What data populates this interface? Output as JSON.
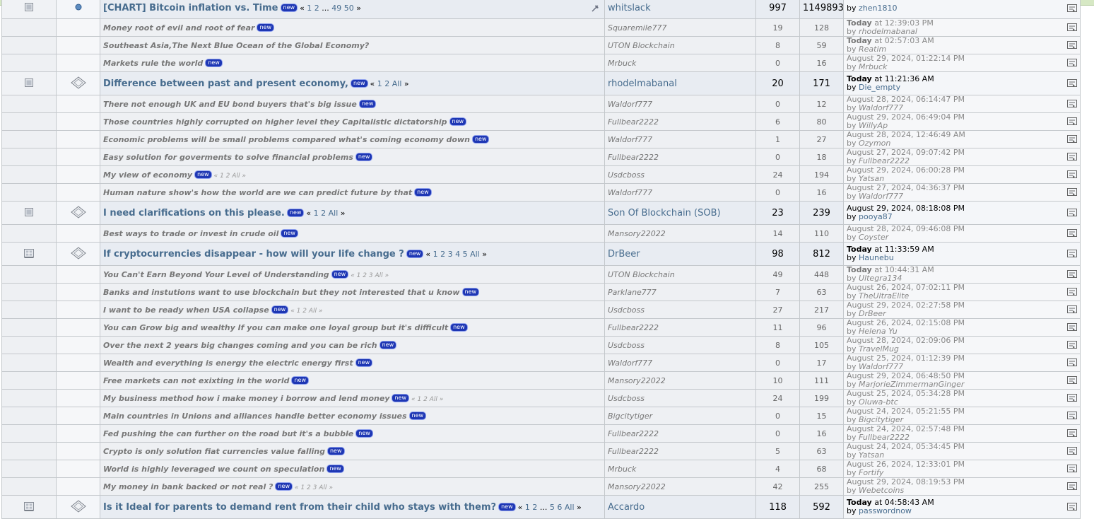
{
  "topics": [
    {
      "kind": "main",
      "top": true,
      "title": "[CHART] Bitcoin inflation vs. Time",
      "new": true,
      "pages": [
        "1",
        "2",
        "...",
        "49",
        "50"
      ],
      "pages_all": "",
      "starter": "whitslack",
      "replies": "997",
      "views": "1149893",
      "lp_date_bold": "",
      "lp_date": "",
      "lp_user": "zhen1810",
      "status_icon": "doc",
      "type_icon": "pin",
      "pinned": true
    },
    {
      "kind": "sub",
      "title": "Money root of evil and root of fear",
      "new": true,
      "pages": [],
      "pages_all": "",
      "starter": "Squaremile777",
      "replies": "19",
      "views": "128",
      "lp_date_bold": "Today",
      "lp_date": "at 12:39:03 PM",
      "lp_user": "rhodelmabanal"
    },
    {
      "kind": "sub",
      "title": "Southeast Asia,The Next Blue Ocean of the Global Economy?",
      "new": false,
      "pages": [],
      "pages_all": "",
      "starter": "UTON Blockchain",
      "replies": "8",
      "views": "59",
      "lp_date_bold": "Today",
      "lp_date": "at 02:57:03 AM",
      "lp_user": "Reatim"
    },
    {
      "kind": "sub",
      "title": "Markets rule the world",
      "new": true,
      "pages": [],
      "pages_all": "",
      "starter": "Mrbuck",
      "replies": "0",
      "views": "16",
      "lp_date_bold": "",
      "lp_date": "August 29, 2024, 01:22:14 PM",
      "lp_user": "Mrbuck"
    },
    {
      "kind": "main",
      "title": "Difference between past and present economy,",
      "new": true,
      "pages": [
        "1",
        "2"
      ],
      "pages_all": "All",
      "starter": "rhodelmabanal",
      "replies": "20",
      "views": "171",
      "lp_date_bold": "Today",
      "lp_date": "at 11:21:36 AM",
      "lp_user": "Die_empty",
      "status_icon": "doc",
      "type_icon": "chat"
    },
    {
      "kind": "sub",
      "title": "There not enough UK and EU bond buyers that's big issue",
      "new": true,
      "pages": [],
      "pages_all": "",
      "starter": "Waldorf777",
      "replies": "0",
      "views": "12",
      "lp_date_bold": "",
      "lp_date": "August 28, 2024, 06:14:47 PM",
      "lp_user": "Waldorf777"
    },
    {
      "kind": "sub",
      "title": "Those countries highly corrupted on higher level they Capitalistic dictatorship",
      "new": true,
      "pages": [],
      "pages_all": "",
      "starter": "Fullbear2222",
      "replies": "6",
      "views": "80",
      "lp_date_bold": "",
      "lp_date": "August 29, 2024, 06:49:04 PM",
      "lp_user": "WillyAp"
    },
    {
      "kind": "sub",
      "title": "Economic problems will be small problems compared what's coming economy down",
      "new": true,
      "pages": [],
      "pages_all": "",
      "starter": "Waldorf777",
      "replies": "1",
      "views": "27",
      "lp_date_bold": "",
      "lp_date": "August 28, 2024, 12:46:49 AM",
      "lp_user": "Ozymon"
    },
    {
      "kind": "sub",
      "title": "Easy solution for goverments to solve financial problems",
      "new": true,
      "pages": [],
      "pages_all": "",
      "starter": "Fullbear2222",
      "replies": "0",
      "views": "18",
      "lp_date_bold": "",
      "lp_date": "August 27, 2024, 09:07:42 PM",
      "lp_user": "Fullbear2222"
    },
    {
      "kind": "sub",
      "title": "My view of economy",
      "new": true,
      "pages": [
        "1",
        "2"
      ],
      "pages_all": "All",
      "starter": "Usdcboss",
      "replies": "24",
      "views": "194",
      "lp_date_bold": "",
      "lp_date": "August 29, 2024, 06:00:28 PM",
      "lp_user": "Yatsan"
    },
    {
      "kind": "sub",
      "title": "Human nature show's how the world are we can predict future by that",
      "new": true,
      "pages": [],
      "pages_all": "",
      "starter": "Waldorf777",
      "replies": "0",
      "views": "16",
      "lp_date_bold": "",
      "lp_date": "August 27, 2024, 04:36:37 PM",
      "lp_user": "Waldorf777"
    },
    {
      "kind": "main",
      "title": "I need clarifications on this please.",
      "new": true,
      "pages": [
        "1",
        "2"
      ],
      "pages_all": "All",
      "starter": "Son Of Blockchain (SOB)",
      "replies": "23",
      "views": "239",
      "lp_date_bold": "",
      "lp_date": "August 29, 2024, 08:18:08 PM",
      "lp_user": "pooya87",
      "status_icon": "doc",
      "type_icon": "chat"
    },
    {
      "kind": "sub",
      "title": "Best ways to trade or invest in crude oil",
      "new": true,
      "pages": [],
      "pages_all": "",
      "starter": "Mansory22022",
      "replies": "14",
      "views": "110",
      "lp_date_bold": "",
      "lp_date": "August 28, 2024, 09:46:08 PM",
      "lp_user": "Coyster"
    },
    {
      "kind": "main",
      "title": "If cryptocurrencies disappear - how will your life change ?",
      "new": true,
      "pages": [
        "1",
        "2",
        "3",
        "4",
        "5"
      ],
      "pages_all": "All",
      "starter": "DrBeer",
      "replies": "98",
      "views": "812",
      "lp_date_bold": "Today",
      "lp_date": "at 11:33:59 AM",
      "lp_user": "Haunebu",
      "status_icon": "hot",
      "type_icon": "chat"
    },
    {
      "kind": "sub",
      "title": "You Can't Earn Beyond Your Level of Understanding",
      "new": true,
      "pages": [
        "1",
        "2",
        "3"
      ],
      "pages_all": "All",
      "starter": "UTON Blockchain",
      "replies": "49",
      "views": "448",
      "lp_date_bold": "Today",
      "lp_date": "at 10:44:31 AM",
      "lp_user": "Ultegra134"
    },
    {
      "kind": "sub",
      "title": "Banks and instutions want to use blockchain but they not interested that u know",
      "new": true,
      "pages": [],
      "pages_all": "",
      "starter": "Parklane777",
      "replies": "7",
      "views": "63",
      "lp_date_bold": "",
      "lp_date": "August 26, 2024, 07:02:11 PM",
      "lp_user": "TheUltraElite"
    },
    {
      "kind": "sub",
      "title": "I want to be ready when USA collapse",
      "new": true,
      "pages": [
        "1",
        "2"
      ],
      "pages_all": "All",
      "starter": "Usdcboss",
      "replies": "27",
      "views": "217",
      "lp_date_bold": "",
      "lp_date": "August 29, 2024, 02:27:58 PM",
      "lp_user": "DrBeer"
    },
    {
      "kind": "sub",
      "title": "You can Grow big and wealthy If you can make one loyal group but it's difficult",
      "new": true,
      "pages": [],
      "pages_all": "",
      "starter": "Fullbear2222",
      "replies": "11",
      "views": "96",
      "lp_date_bold": "",
      "lp_date": "August 26, 2024, 02:15:08 PM",
      "lp_user": "Helena Yu"
    },
    {
      "kind": "sub",
      "title": "Over the next 2 years big changes coming and you can be rich",
      "new": true,
      "pages": [],
      "pages_all": "",
      "starter": "Usdcboss",
      "replies": "8",
      "views": "105",
      "lp_date_bold": "",
      "lp_date": "August 28, 2024, 02:09:06 PM",
      "lp_user": "TravelMug"
    },
    {
      "kind": "sub",
      "title": "Wealth and everything is energy the electric energy first",
      "new": true,
      "pages": [],
      "pages_all": "",
      "starter": "Waldorf777",
      "replies": "0",
      "views": "17",
      "lp_date_bold": "",
      "lp_date": "August 25, 2024, 01:12:39 PM",
      "lp_user": "Waldorf777"
    },
    {
      "kind": "sub",
      "title": "Free markets can not exixting in the world",
      "new": true,
      "pages": [],
      "pages_all": "",
      "starter": "Mansory22022",
      "replies": "10",
      "views": "111",
      "lp_date_bold": "",
      "lp_date": "August 29, 2024, 06:48:50 PM",
      "lp_user": "MarjorieZimmermanGinger"
    },
    {
      "kind": "sub",
      "title": "My business method how i make money i borrow and lend money",
      "new": true,
      "pages": [
        "1",
        "2"
      ],
      "pages_all": "All",
      "starter": "Usdcboss",
      "replies": "24",
      "views": "199",
      "lp_date_bold": "",
      "lp_date": "August 25, 2024, 05:34:28 PM",
      "lp_user": "Oluwa-btc"
    },
    {
      "kind": "sub",
      "title": "Main countries in Unions and alliances handle better economy issues",
      "new": true,
      "pages": [],
      "pages_all": "",
      "starter": "Bigcitytiger",
      "replies": "0",
      "views": "15",
      "lp_date_bold": "",
      "lp_date": "August 24, 2024, 05:21:55 PM",
      "lp_user": "Bigcitytiger"
    },
    {
      "kind": "sub",
      "title": "Fed pushing the can further on the road but it's a bubble",
      "new": true,
      "pages": [],
      "pages_all": "",
      "starter": "Fullbear2222",
      "replies": "0",
      "views": "16",
      "lp_date_bold": "",
      "lp_date": "August 24, 2024, 02:57:48 PM",
      "lp_user": "Fullbear2222"
    },
    {
      "kind": "sub",
      "title": "Crypto is only solution fiat currencies value falling",
      "new": true,
      "pages": [],
      "pages_all": "",
      "starter": "Fullbear2222",
      "replies": "5",
      "views": "63",
      "lp_date_bold": "",
      "lp_date": "August 24, 2024, 05:34:45 PM",
      "lp_user": "Yatsan"
    },
    {
      "kind": "sub",
      "title": "World is highly leveraged we count on speculation",
      "new": true,
      "pages": [],
      "pages_all": "",
      "starter": "Mrbuck",
      "replies": "4",
      "views": "68",
      "lp_date_bold": "",
      "lp_date": "August 26, 2024, 12:33:01 PM",
      "lp_user": "Fortify"
    },
    {
      "kind": "sub",
      "title": "My money in bank backed or not real ?",
      "new": true,
      "pages": [
        "1",
        "2",
        "3"
      ],
      "pages_all": "All",
      "starter": "Mansory22022",
      "replies": "42",
      "views": "255",
      "lp_date_bold": "",
      "lp_date": "August 29, 2024, 08:19:53 PM",
      "lp_user": "Webetcoins"
    },
    {
      "kind": "main",
      "title": "Is it Ideal for parents to demand rent from their child who stays with them?",
      "new": true,
      "pages": [
        "1",
        "2",
        "...",
        "5",
        "6"
      ],
      "pages_all": "All",
      "starter": "Accardo",
      "replies": "118",
      "views": "592",
      "lp_date_bold": "Today",
      "lp_date": "at 04:58:43 AM",
      "lp_user": "passwordnow",
      "status_icon": "hot",
      "type_icon": "chat"
    }
  ],
  "labels": {
    "new_badge": "new",
    "by": "by",
    "page_prev": "«",
    "page_next": "»"
  },
  "colors": {
    "link": "#476c8e",
    "badge": "#1e37b4",
    "row_main": "#e8ecf2",
    "row_sub": "#eef0f3",
    "border": "#c4c8cc"
  }
}
